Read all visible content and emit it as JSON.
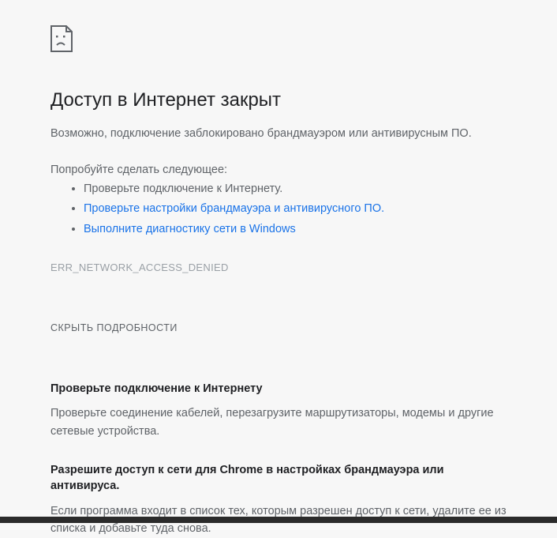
{
  "error": {
    "title": "Доступ в Интернет закрыт",
    "subtitle": "Возможно, подключение заблокировано брандмауэром или антивирусным ПО.",
    "try_label": "Попробуйте сделать следующее:",
    "suggestions": {
      "check_connection": "Проверьте подключение к Интернету.",
      "check_firewall": "Проверьте настройки брандмауэра и антивирусного ПО.",
      "run_diagnostics": "Выполните диагностику сети в Windows"
    },
    "code": "ERR_NETWORK_ACCESS_DENIED",
    "toggle_details": "СКРЫТЬ ПОДРОБНОСТИ",
    "details": {
      "section1": {
        "title": "Проверьте подключение к Интернету",
        "body": "Проверьте соединение кабелей, перезагрузите маршрутизаторы, модемы и другие сетевые устройства."
      },
      "section2": {
        "title": "Разрешите доступ к сети для Chrome в настройках брандмауэра или антивируса.",
        "body": "Если программа входит в список тех, которым разрешен доступ к сети, удалите ее из списка и добавьте туда снова."
      }
    }
  }
}
